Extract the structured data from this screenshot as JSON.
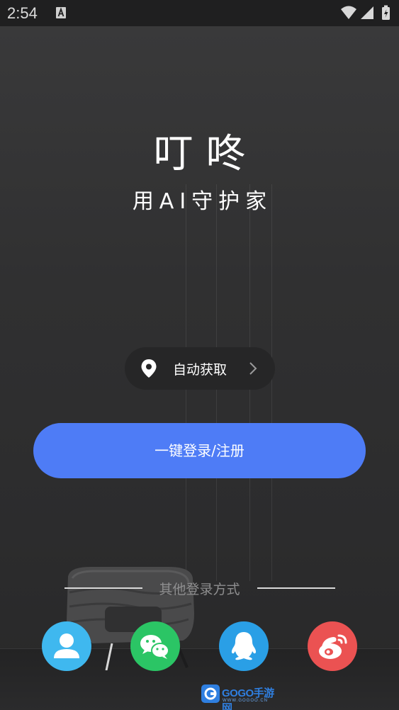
{
  "status_bar": {
    "time": "2:54",
    "notification_icon": "a-letter-icon",
    "icons": [
      "wifi-icon",
      "signal-icon",
      "battery-icon"
    ]
  },
  "app": {
    "title": "叮咚",
    "subtitle": "用AI守护家"
  },
  "location": {
    "label": "自动获取",
    "icon": "location-pin-icon"
  },
  "login_button": {
    "label": "一键登录/注册"
  },
  "other_login": {
    "label": "其他登录方式",
    "methods": [
      {
        "name": "account",
        "icon": "user-icon",
        "color": "#3fb8ef"
      },
      {
        "name": "wechat",
        "icon": "wechat-icon",
        "color": "#2bc565"
      },
      {
        "name": "qq",
        "icon": "qq-icon",
        "color": "#2a9fe6"
      },
      {
        "name": "weibo",
        "icon": "weibo-icon",
        "color": "#eb5252"
      }
    ]
  },
  "watermark": {
    "text": "GOGO手游网",
    "sub": "WWW.GOGOO.CN"
  },
  "colors": {
    "primary": "#4e7cf6",
    "background": "#2f2f30"
  }
}
